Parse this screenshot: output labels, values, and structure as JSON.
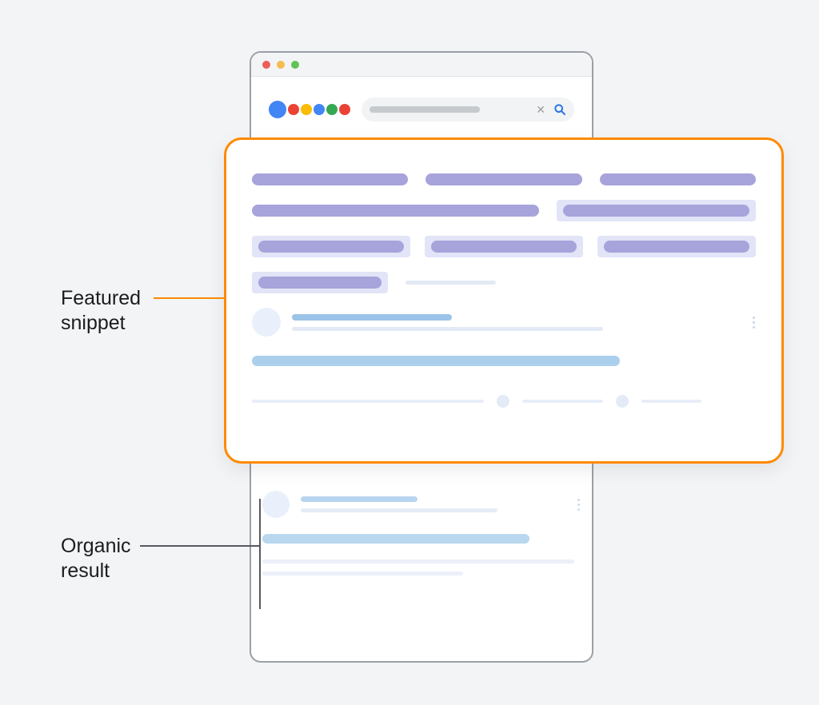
{
  "labels": {
    "featured_line1": "Featured",
    "featured_line2": "snippet",
    "organic_line1": "Organic",
    "organic_line2": "result"
  },
  "colors": {
    "highlight_border": "#ff8a00",
    "purple_bar": "#a7a3db",
    "purple_tint": "#e2e4f7",
    "link_blue": "#abd0ee",
    "search_icon": "#2a74e6"
  },
  "browser": {
    "traffic_lights": [
      "close",
      "minimize",
      "zoom"
    ],
    "logo_colors": [
      "blue",
      "red",
      "yellow",
      "blue",
      "green",
      "red"
    ]
  }
}
